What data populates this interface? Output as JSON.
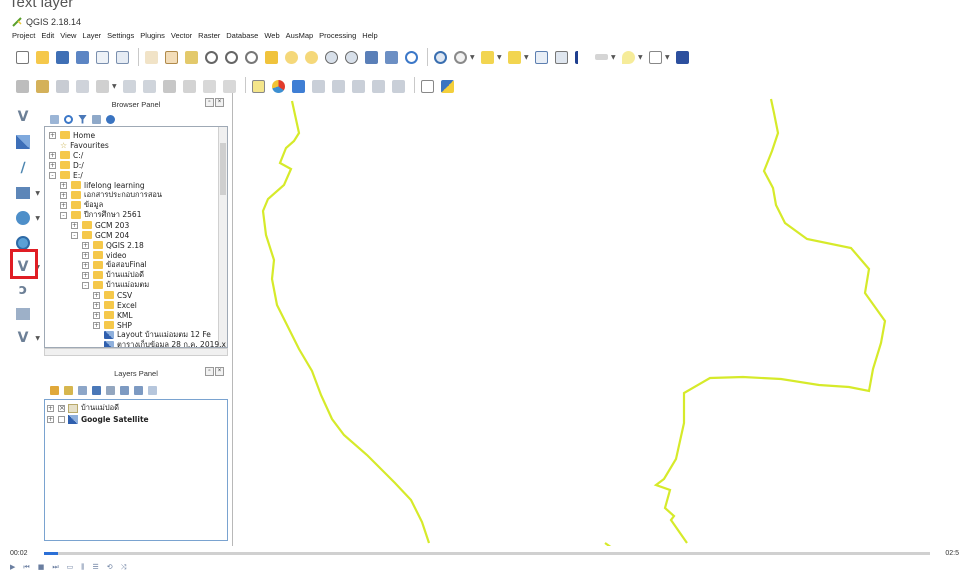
{
  "caption": "Text layer",
  "window": {
    "title": "QGIS 2.18.14"
  },
  "menu": [
    "Project",
    "Edit",
    "View",
    "Layer",
    "Settings",
    "Plugins",
    "Vector",
    "Raster",
    "Database",
    "Web",
    "AusMap",
    "Processing",
    "Help"
  ],
  "browser_panel": {
    "title": "Browser Panel",
    "tree": [
      {
        "label": "Home",
        "kind": "folder",
        "level": 0,
        "expander": "+"
      },
      {
        "label": "Favourites",
        "kind": "star",
        "level": 0,
        "expander": ""
      },
      {
        "label": "C:/",
        "kind": "folder",
        "level": 0,
        "expander": "+"
      },
      {
        "label": "D:/",
        "kind": "folder",
        "level": 0,
        "expander": "+"
      },
      {
        "label": "E:/",
        "kind": "folder",
        "level": 0,
        "expander": "-"
      },
      {
        "label": "lifelong learning",
        "kind": "folder",
        "level": 1,
        "expander": "+"
      },
      {
        "label": "เอกสารประกอบการสอน",
        "kind": "folder",
        "level": 1,
        "expander": "+"
      },
      {
        "label": "ข้อมูล",
        "kind": "folder",
        "level": 1,
        "expander": "+"
      },
      {
        "label": "ปีการศึกษา 2561",
        "kind": "folder",
        "level": 1,
        "expander": "-"
      },
      {
        "label": "GCM 203",
        "kind": "folder",
        "level": 2,
        "expander": "+"
      },
      {
        "label": "GCM 204",
        "kind": "folder",
        "level": 2,
        "expander": "-"
      },
      {
        "label": "QGIS 2.18",
        "kind": "folder",
        "level": 3,
        "expander": "+"
      },
      {
        "label": "video",
        "kind": "folder",
        "level": 3,
        "expander": "+"
      },
      {
        "label": "ข้อสอบFinal",
        "kind": "folder",
        "level": 3,
        "expander": "+"
      },
      {
        "label": "บ้านแม่ปอดี",
        "kind": "folder",
        "level": 3,
        "expander": "+"
      },
      {
        "label": "บ้านแม่อมตม",
        "kind": "folder",
        "level": 3,
        "expander": "-"
      },
      {
        "label": "CSV",
        "kind": "folder",
        "level": 4,
        "expander": "+"
      },
      {
        "label": "Excel",
        "kind": "folder",
        "level": 4,
        "expander": "+"
      },
      {
        "label": "KML",
        "kind": "folder",
        "level": 4,
        "expander": "+"
      },
      {
        "label": "SHP",
        "kind": "folder",
        "level": 4,
        "expander": "+"
      },
      {
        "label": "Layout บ้านแม่อมตม 12 Fe",
        "kind": "raster",
        "level": 4,
        "expander": ""
      },
      {
        "label": "ตารางเก็บข้อมูล 28 ก.ค. 2019.x",
        "kind": "raster",
        "level": 4,
        "expander": ""
      }
    ]
  },
  "layers_panel": {
    "title": "Layers Panel",
    "layers": [
      {
        "label": "บ้านแม่ปอดี",
        "bold": false,
        "checked": true
      },
      {
        "label": "Google Satellite",
        "bold": true,
        "checked": false
      }
    ]
  },
  "timeline": {
    "current": "00:02",
    "end": "02:5",
    "progress": 0.016
  },
  "colors": {
    "boundary_line": "#d6ea2a",
    "highlight": "#e01d24",
    "progress": "#2b6fd6"
  }
}
